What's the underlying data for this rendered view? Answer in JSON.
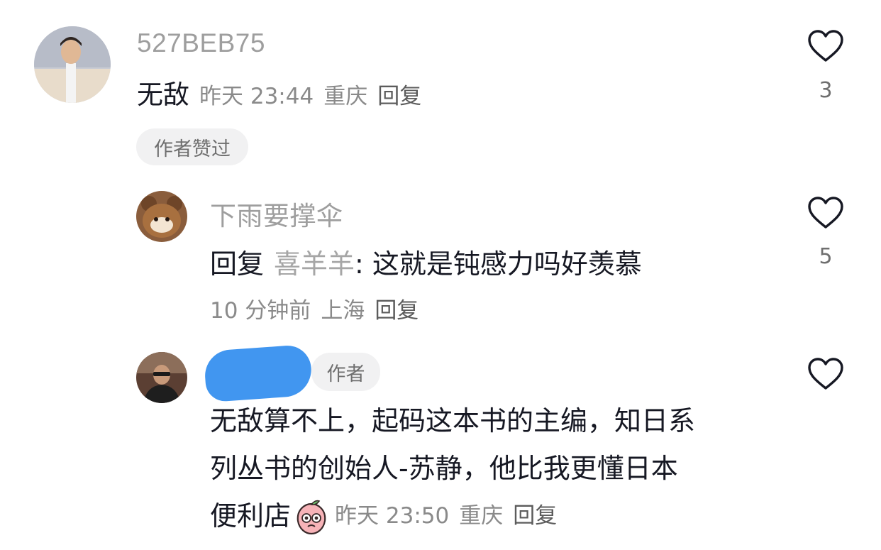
{
  "comments": [
    {
      "username": "527BEB75",
      "text": "无敌",
      "time": "昨天 23:44",
      "location": "重庆",
      "reply_label": "回复",
      "badge": "作者赞过",
      "likes": "3"
    },
    {
      "username": "下雨要撑伞",
      "reply_prefix": "回复",
      "reply_to": "喜羊羊",
      "text": ": 这就是钝感力吗好羡慕",
      "time": "10 分钟前",
      "location": "上海",
      "reply_label": "回复",
      "likes": "5"
    },
    {
      "author_tag": "作者",
      "text_lines": [
        "无敌算不上，起码这本书的主编，知日系",
        "列丛书的创始人-苏静，他比我更懂日本",
        "便利店"
      ],
      "time": "昨天 23:50",
      "location": "重庆",
      "reply_label": "回复"
    }
  ],
  "colors": {
    "redaction_blue": "#4196f0",
    "pill_bg": "#f1f1f2",
    "muted_text": "#9e9e9e"
  },
  "icons": [
    "heart-outline-icon",
    "peach-emoji-icon"
  ]
}
